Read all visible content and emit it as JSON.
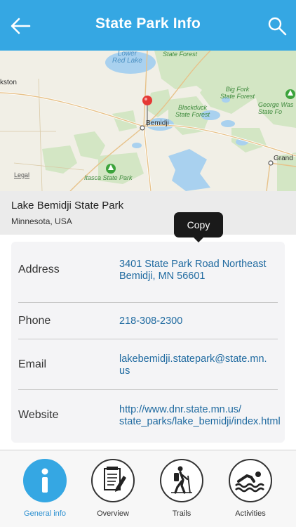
{
  "header": {
    "title": "State Park Info",
    "back_icon": "back-arrow-icon",
    "search_icon": "search-icon",
    "bg_color": "#35a7e3"
  },
  "map": {
    "labels": {
      "lower_red_lake": "Lower\nRed Lake",
      "state_forest_top": "State Forest",
      "big_fork": "Big Fork\nState Forest",
      "george_washington": "George Was\nState Fo",
      "blackduck": "Blackduck\nState Forest",
      "bemidji": "Bemidji",
      "itasca": "Itasca State Park",
      "grand": "Grand",
      "kston": "kston",
      "legal": "Legal"
    }
  },
  "place": {
    "name": "Lake Bemidji State Park",
    "region": "Minnesota, USA"
  },
  "tooltip": {
    "label": "Copy"
  },
  "details": {
    "address": {
      "label": "Address",
      "value": "3401 State Park Road Northeast\nBemidji, MN 56601"
    },
    "phone": {
      "label": "Phone",
      "value": "218-308-2300"
    },
    "email": {
      "label": "Email",
      "value": "lakebemidji.statepark@state.mn.\nus"
    },
    "website": {
      "label": "Website",
      "value": "http://www.dnr.state.mn.us/\nstate_parks/lake_bemidji/index.html"
    }
  },
  "tabs": [
    {
      "label": "General info",
      "icon": "info-icon",
      "active": true
    },
    {
      "label": "Overview",
      "icon": "overview-document-icon",
      "active": false
    },
    {
      "label": "Trails",
      "icon": "hiker-icon",
      "active": false
    },
    {
      "label": "Activities",
      "icon": "swimmer-icon",
      "active": false
    }
  ],
  "colors": {
    "accent": "#35a7e3",
    "link": "#1f6aa0"
  }
}
